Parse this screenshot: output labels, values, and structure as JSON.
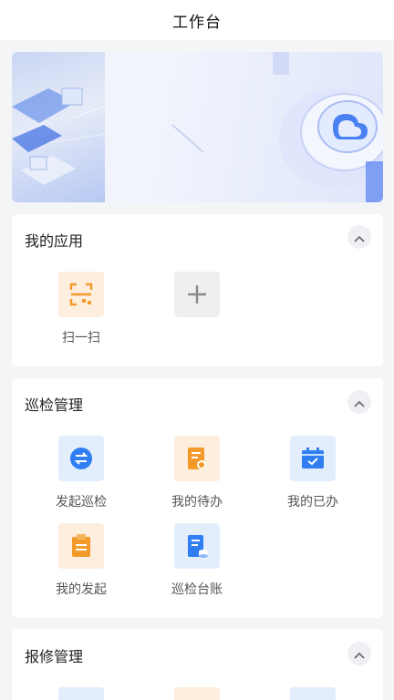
{
  "header": {
    "title": "工作台"
  },
  "banner": {
    "page_count": 2,
    "active_index": 1
  },
  "sections": {
    "my_apps": {
      "title": "我的应用",
      "items": [
        {
          "label": "扫一扫",
          "icon": "scan-icon"
        },
        {
          "label": "",
          "icon": "plus-icon"
        }
      ]
    },
    "inspection": {
      "title": "巡检管理",
      "items": [
        {
          "label": "发起巡检",
          "icon": "swap-arrows-icon"
        },
        {
          "label": "我的待办",
          "icon": "todo-document-icon"
        },
        {
          "label": "我的已办",
          "icon": "calendar-check-icon"
        },
        {
          "label": "我的发起",
          "icon": "clipboard-icon"
        },
        {
          "label": "巡检台账",
          "icon": "ledger-icon"
        }
      ]
    },
    "repair": {
      "title": "报修管理"
    }
  },
  "colors": {
    "accent_blue": "#2f7ef2",
    "accent_orange": "#f39a2a",
    "icon_bg_orange": "#fdeedd",
    "icon_bg_blue": "#e2eefc"
  }
}
